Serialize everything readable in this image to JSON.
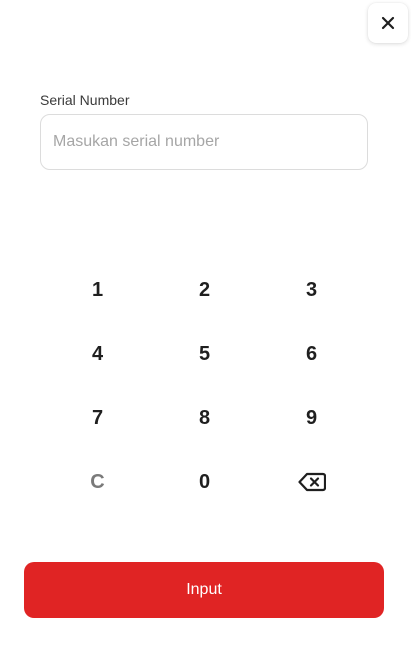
{
  "close_button": {
    "icon": "close-icon"
  },
  "form": {
    "serial_label": "Serial Number",
    "serial_value": "",
    "serial_placeholder": "Masukan serial number"
  },
  "keypad": {
    "keys": [
      "1",
      "2",
      "3",
      "4",
      "5",
      "6",
      "7",
      "8",
      "9",
      "C",
      "0"
    ],
    "backspace_icon": "backspace-icon"
  },
  "submit": {
    "label": "Input",
    "color": "#e02424"
  }
}
